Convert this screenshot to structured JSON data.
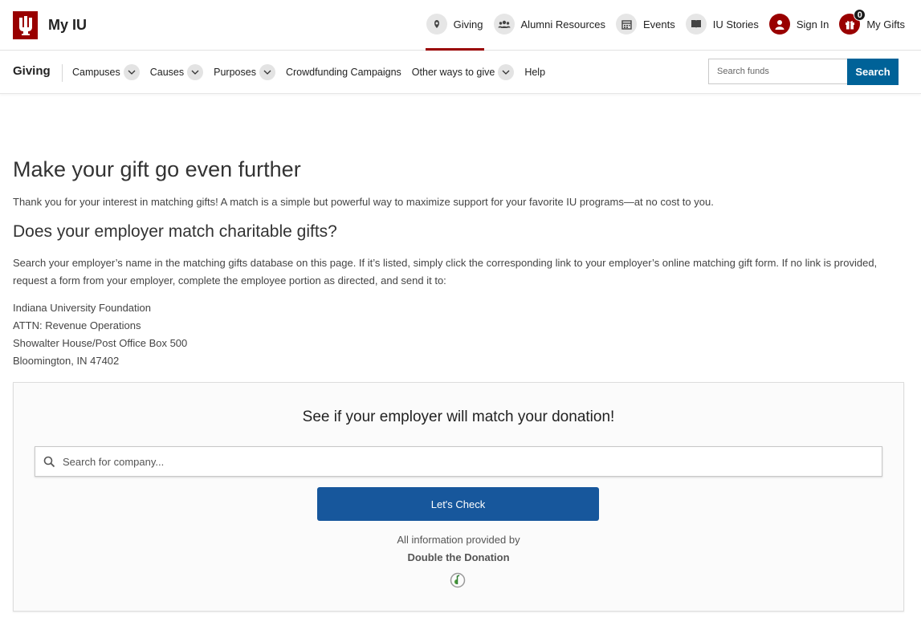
{
  "header": {
    "title": "My IU",
    "nav": [
      {
        "label": "Giving",
        "icon": "giving-icon",
        "active": true
      },
      {
        "label": "Alumni Resources",
        "icon": "people-icon"
      },
      {
        "label": "Events",
        "icon": "calendar-icon"
      },
      {
        "label": "IU Stories",
        "icon": "book-icon"
      },
      {
        "label": "Sign In",
        "icon": "user-icon"
      },
      {
        "label": "My Gifts",
        "icon": "gift-icon",
        "badge": "0"
      }
    ]
  },
  "subnav": {
    "title": "Giving",
    "links": [
      {
        "label": "Campuses",
        "dropdown": true
      },
      {
        "label": "Causes",
        "dropdown": true
      },
      {
        "label": "Purposes",
        "dropdown": true
      },
      {
        "label": "Crowdfunding Campaigns",
        "dropdown": false
      },
      {
        "label": "Other ways to give",
        "dropdown": true
      },
      {
        "label": "Help",
        "dropdown": false
      }
    ],
    "search_placeholder": "Search funds",
    "search_button": "Search"
  },
  "main": {
    "heading": "Make your gift go even further",
    "intro": "Thank you for your interest in matching gifts! A match is a simple but powerful way to maximize support for your favorite IU programs—at no cost to you.",
    "subheading": "Does your employer match charitable gifts?",
    "paragraph": "Search your employer’s name in the matching gifts database on this page. If it’s listed, simply click the corresponding link to your employer’s online matching gift form. If no link is provided, request a form from your employer, complete the employee portion as directed, and send it to:",
    "address": [
      "Indiana University Foundation",
      "ATTN: Revenue Operations",
      "Showalter House/Post Office Box 500",
      "Bloomington, IN 47402"
    ]
  },
  "match_widget": {
    "title": "See if your employer will match your donation!",
    "input_placeholder": "Search for company...",
    "button": "Let's Check",
    "provided_by": "All information provided by",
    "provider": "Double the Donation"
  },
  "colors": {
    "iu_crimson": "#990000",
    "search_blue": "#006298",
    "check_blue": "#17579c"
  }
}
